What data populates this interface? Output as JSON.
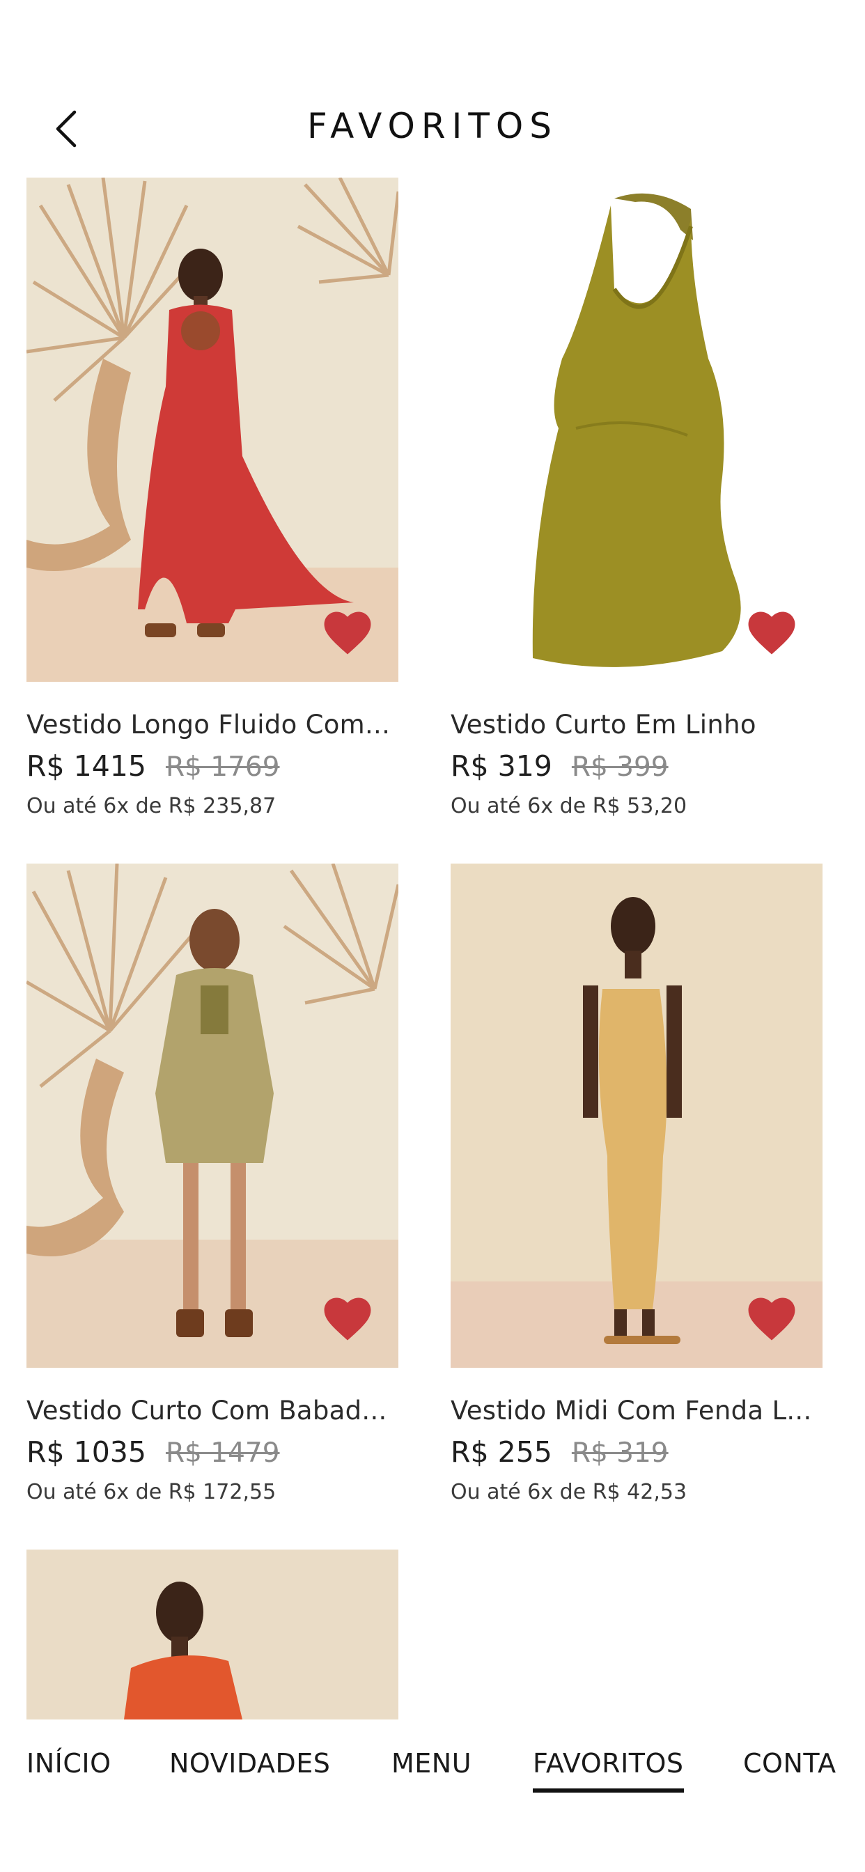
{
  "header": {
    "title": "FAVORITOS"
  },
  "products": [
    {
      "name": "Vestido Longo Fluido Com...",
      "price": "R$ 1415",
      "old_price": "R$ 1769",
      "installment": "Ou até 6x de R$ 235,87"
    },
    {
      "name": "Vestido Curto Em Linho",
      "price": "R$ 319",
      "old_price": "R$ 399",
      "installment": "Ou até 6x de R$ 53,20"
    },
    {
      "name": "Vestido Curto Com Babad...",
      "price": "R$ 1035",
      "old_price": "R$ 1479",
      "installment": "Ou até 6x de R$ 172,55"
    },
    {
      "name": "Vestido Midi Com Fenda L...",
      "price": "R$ 255",
      "old_price": "R$ 319",
      "installment": "Ou até 6x de R$ 42,53"
    }
  ],
  "nav": {
    "items": [
      {
        "label": "INÍCIO"
      },
      {
        "label": "NOVIDADES"
      },
      {
        "label": "MENU"
      },
      {
        "label": "FAVORITOS",
        "active": true
      },
      {
        "label": "CONTA"
      }
    ]
  },
  "colors": {
    "heart": "#c8383c",
    "text": "#1a1a1a",
    "old_price": "#8a8a8a",
    "sand": "#e8d2b6",
    "beige_bg": "#e9dcc3"
  },
  "icons": {
    "back": "chevron-left-icon",
    "favorite": "heart-icon"
  }
}
